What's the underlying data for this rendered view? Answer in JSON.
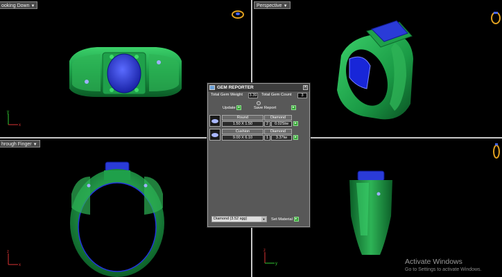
{
  "viewports": {
    "top_left": "ooking Down",
    "top_right": "Perspective",
    "bottom_left": "hrough Finger"
  },
  "axes": {
    "x": "x",
    "y": "y",
    "z": "z"
  },
  "gem_reporter": {
    "title": "GEM REPORTER",
    "total_weight_label": "Total Gem Weight",
    "total_weight_value": "3.39",
    "total_count_label": "Total Gem Count",
    "total_count_value": "3",
    "update_label": "Update",
    "save_report_label": "Save Report",
    "gems": [
      {
        "shape": "Round",
        "material": "Diamond",
        "size": "1.50 X 1.50",
        "count": "2",
        "weight": "0.02Stw"
      },
      {
        "shape": "Cushion",
        "material": "Diamond",
        "size": "9.00 X 6.10",
        "count": "1",
        "weight": "3.37tw"
      }
    ],
    "material_select": "Diamond    (3.52 sgg)",
    "set_material_label": "Set Material",
    "button_icon": "▸"
  },
  "watermark": {
    "title": "Activate Windows",
    "subtitle": "Go to Settings to activate Windows."
  },
  "colors": {
    "ring_green": "#1fa04a",
    "gem_blue": "#2a3bd8",
    "viewport_bg": "#000000"
  }
}
